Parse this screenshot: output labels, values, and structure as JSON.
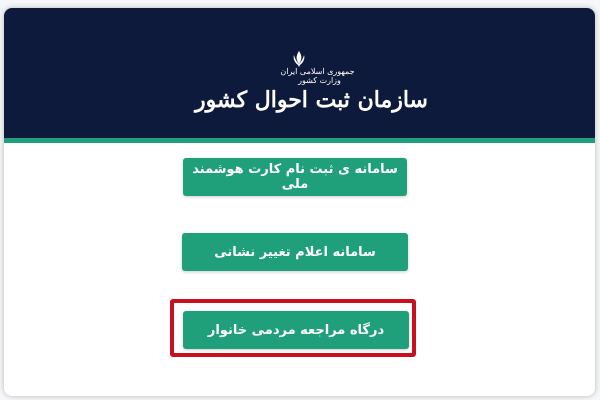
{
  "header": {
    "emblem_icon": "iran-emblem-icon",
    "gov_line1": "جمهوری اسلامی ایران",
    "gov_line2": "وزارت کشور",
    "org_title": "سازمان ثبت احوال کشور",
    "background_color": "#0e1a3b",
    "accent_color": "#1fa07a"
  },
  "buttons": {
    "smart_card_label": "سامانه ی ثبت نام کارت هوشمند ملی",
    "address_change_label": "سامانه اعلام تغییر نشانی",
    "family_portal_label": "درگاه مراجعه مردمی خانوار",
    "button_color": "#1fa07a"
  },
  "highlight": {
    "color": "#c8101e"
  }
}
